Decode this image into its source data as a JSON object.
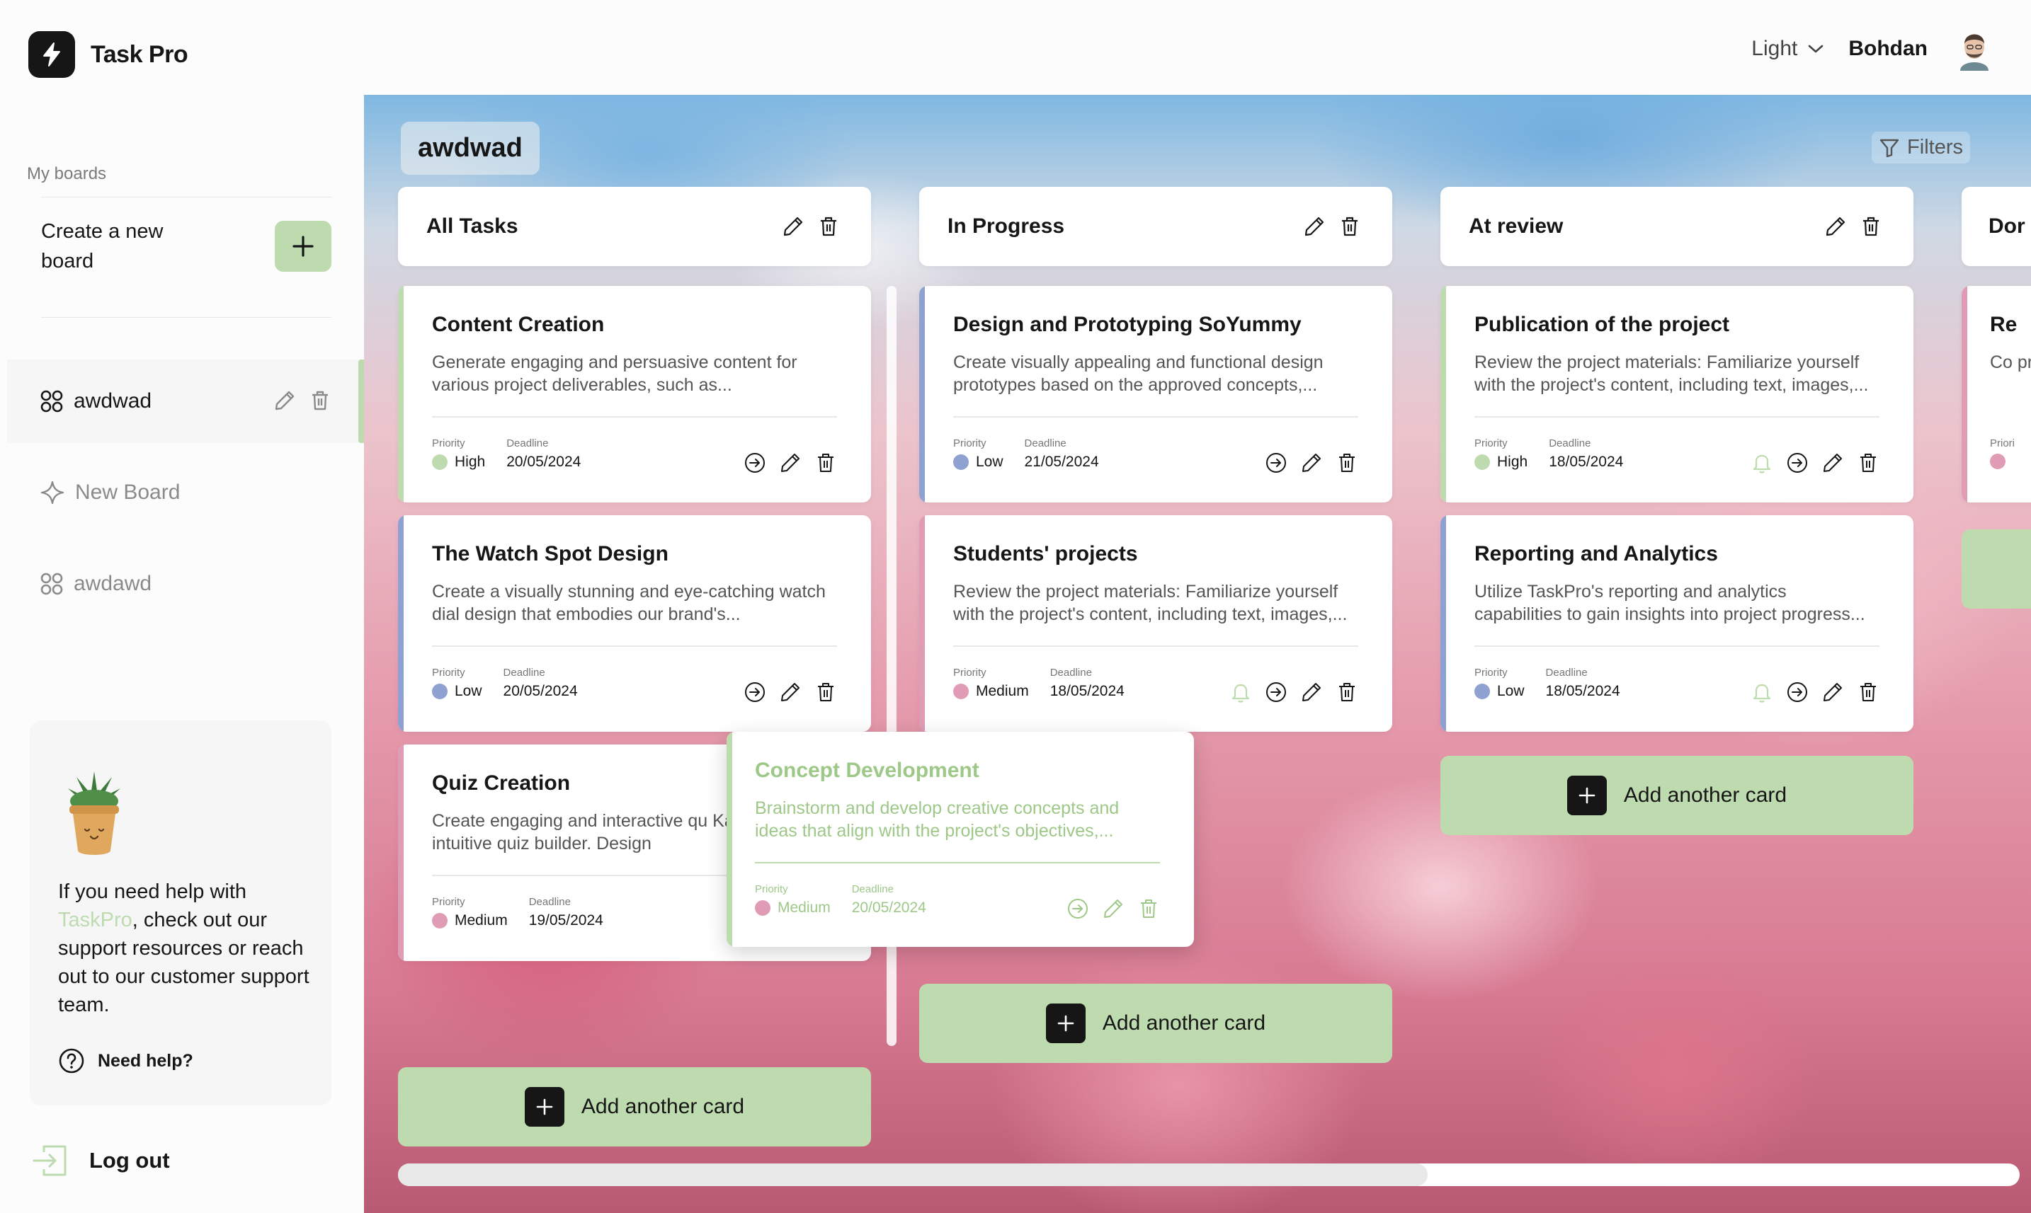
{
  "app": {
    "name": "Task Pro"
  },
  "sidebar": {
    "my_boards_title": "My boards",
    "create_board_label": "Create a new board",
    "boards": [
      {
        "name": "awdwad",
        "icon": "grid-icon",
        "active": true
      },
      {
        "name": "New Board",
        "icon": "sparkle-icon",
        "active": false
      },
      {
        "name": "awdawd",
        "icon": "grid-icon",
        "active": false
      }
    ],
    "help": {
      "text_before": "If you need help with ",
      "accent": "TaskPro",
      "text_after": ", check out our support resources or reach out to our customer support team.",
      "link_label": "Need help?"
    },
    "logout_label": "Log out"
  },
  "header": {
    "theme": "Light",
    "user_name": "Bohdan"
  },
  "board": {
    "title": "awdwad",
    "filters_label": "Filters",
    "add_card_label": "Add another card",
    "priority_label": "Priority",
    "deadline_label": "Deadline",
    "columns": [
      {
        "title": "All Tasks"
      },
      {
        "title": "In Progress"
      },
      {
        "title": "At review"
      },
      {
        "title": "Dor"
      }
    ],
    "cards": {
      "c1": {
        "title": "Content Creation",
        "desc": "Generate engaging and persuasive content for various project deliverables, such as...",
        "priority": "High",
        "deadline": "20/05/2024"
      },
      "c2": {
        "title": "The Watch Spot Design",
        "desc": "Create a visually stunning and eye-catching watch dial design that embodies our brand's...",
        "priority": "Low",
        "deadline": "20/05/2024"
      },
      "c3": {
        "title": "Quiz Creation",
        "desc": "Create engaging and interactive qu Kahoot's intuitive quiz builder. Design",
        "priority": "Medium",
        "deadline": "19/05/2024"
      },
      "c4": {
        "title": "Design and Prototyping SoYummy",
        "desc": "Create visually appealing and functional design prototypes based on the approved concepts,...",
        "priority": "Low",
        "deadline": "21/05/2024"
      },
      "c5": {
        "title": "Students' projects",
        "desc": "Review the project materials: Familiarize yourself with the project's content, including text, images,...",
        "priority": "Medium",
        "deadline": "18/05/2024"
      },
      "c6": {
        "title": "Publication of the project",
        "desc": "Review the project materials: Familiarize yourself with the project's content, including text, images,...",
        "priority": "High",
        "deadline": "18/05/2024"
      },
      "c7": {
        "title": "Reporting and Analytics",
        "desc": "Utilize TaskPro's reporting and analytics capabilities to gain insights into project progress...",
        "priority": "Low",
        "deadline": "18/05/2024"
      },
      "c8": {
        "title": "Concept Development",
        "desc": "Brainstorm and develop creative concepts and ideas that align with the project's objectives,...",
        "priority": "Medium",
        "deadline": "20/05/2024"
      },
      "c9": {
        "title": "Re",
        "desc": "Co pro",
        "priority": "",
        "deadline": "",
        "priority_label": "Priori"
      }
    }
  },
  "colors": {
    "accent": "#bedbb0",
    "high": "#bedbb0",
    "medium": "#e09cb5",
    "low": "#8fa1d0",
    "dark": "#161616"
  }
}
